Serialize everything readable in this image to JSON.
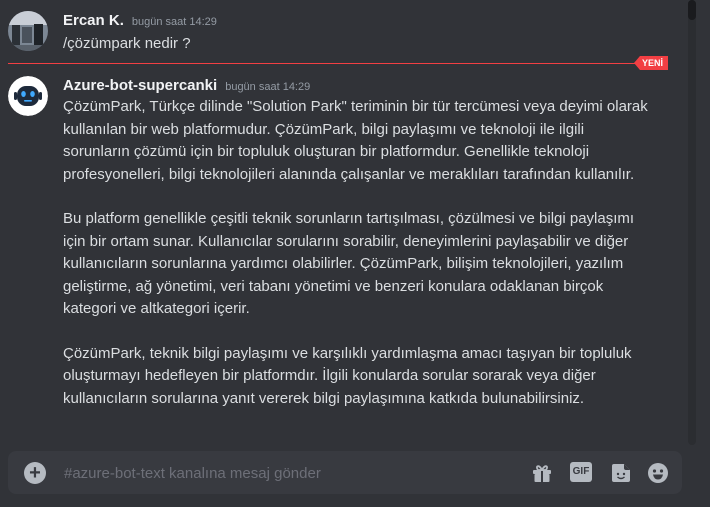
{
  "messages": [
    {
      "author": "Ercan K.",
      "timestamp": "bugün saat 14:29",
      "text": "/çözümpark nedir ?"
    },
    {
      "author": "Azure-bot-supercanki",
      "timestamp": "bugün saat 14:29",
      "paragraphs": [
        "ÇözümPark, Türkçe dilinde \"Solution Park\" teriminin bir tür tercümesi veya deyimi olarak kullanılan bir web platformudur. ÇözümPark, bilgi paylaşımı ve teknoloji ile ilgili sorunların çözümü için bir topluluk oluşturan bir platformdur. Genellikle teknoloji profesyonelleri, bilgi teknolojileri alanında çalışanlar ve meraklıları tarafından kullanılır.",
        "Bu platform genellikle çeşitli teknik sorunların tartışılması, çözülmesi ve bilgi paylaşımı için bir ortam sunar. Kullanıcılar sorularını sorabilir, deneyimlerini paylaşabilir ve diğer kullanıcıların sorunlarına yardımcı olabilirler. ÇözümPark, bilişim teknolojileri, yazılım geliştirme, ağ yönetimi, veri tabanı yönetimi ve benzeri konulara odaklanan birçok kategori ve altkategori içerir.",
        "ÇözümPark, teknik bilgi paylaşımı ve karşılıklı yardımlaşma amacı taşıyan bir topluluk oluşturmayı hedefleyen bir platformdır. İlgili konularda sorular sorarak veya diğer kullanıcıların sorularına yanıt vererek bilgi paylaşımına katkıda bulunabilirsiniz."
      ]
    }
  ],
  "new_badge": "YENİ",
  "composer": {
    "placeholder": "#azure-bot-text kanalına mesaj gönder",
    "gif_label": "GIF"
  },
  "icons": [
    "add-attachment-icon",
    "gift-icon",
    "gif-icon",
    "sticker-icon",
    "emoji-icon"
  ],
  "colors": {
    "background": "#313338",
    "new_line": "#f23f43",
    "composer": "#383a40"
  }
}
